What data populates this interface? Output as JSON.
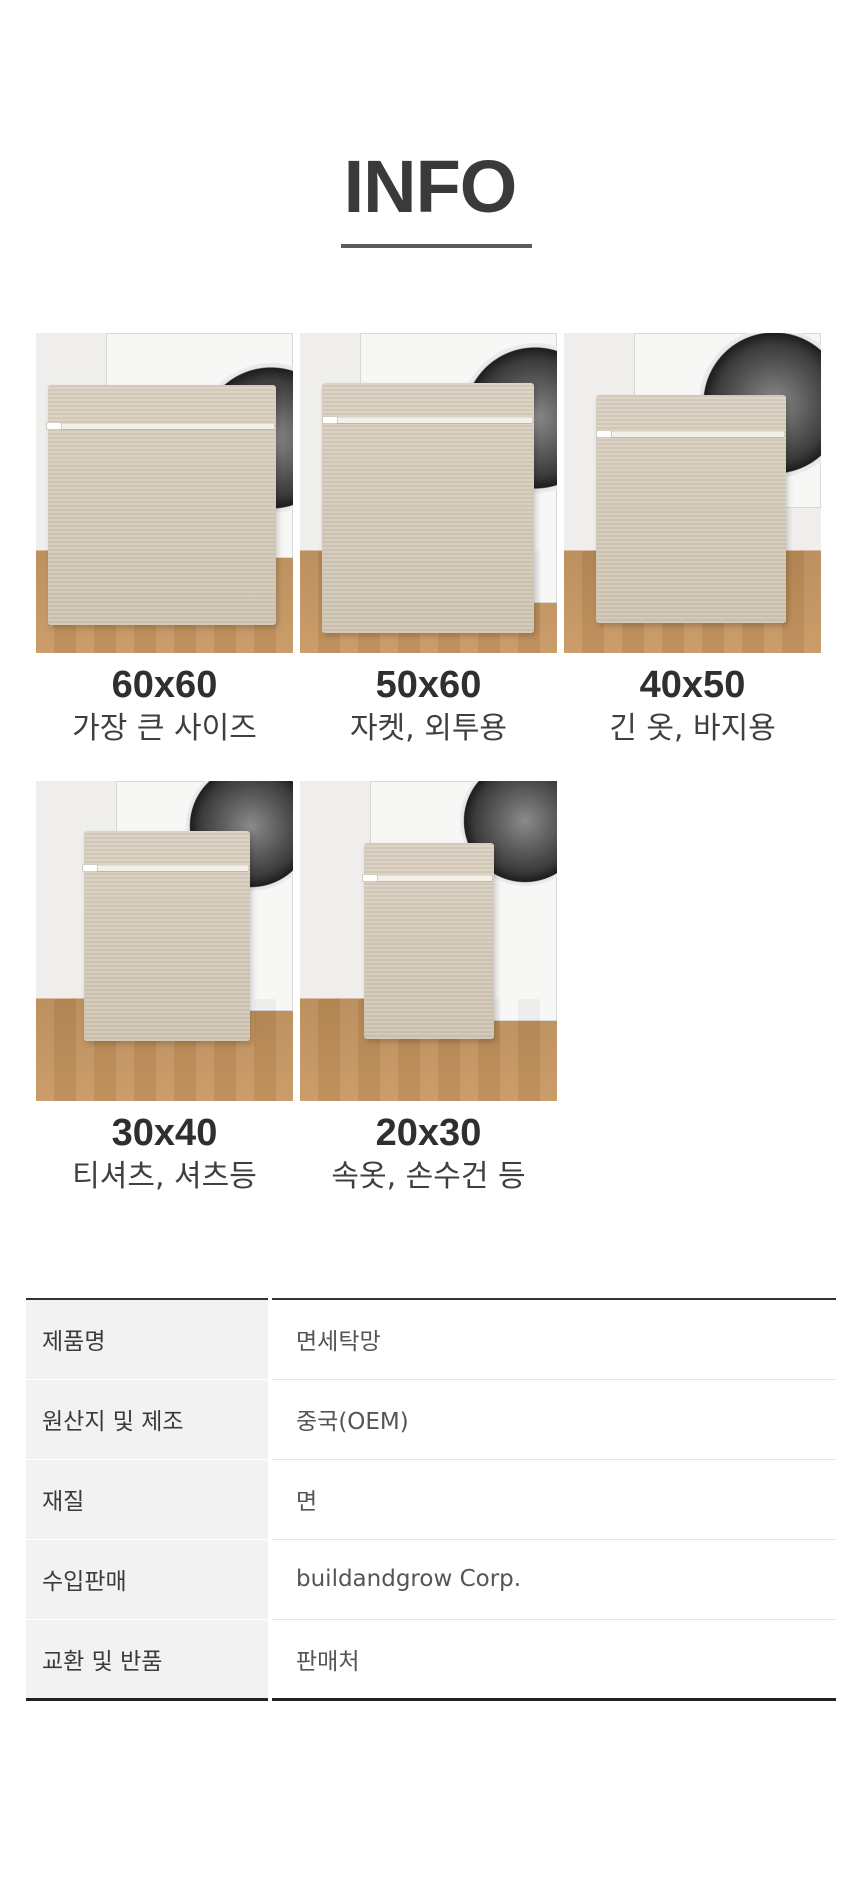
{
  "header": {
    "title": "INFO"
  },
  "products": [
    {
      "size": "60x60",
      "use": "가장 큰 사이즈"
    },
    {
      "size": "50x60",
      "use": "자켓, 외투용"
    },
    {
      "size": "40x50",
      "use": "긴 옷, 바지용"
    },
    {
      "size": "30x40",
      "use": "티셔츠, 셔츠등"
    },
    {
      "size": "20x30",
      "use": "속옷, 손수건 등"
    }
  ],
  "spec_table": [
    {
      "label": "제품명",
      "value": "면세탁망"
    },
    {
      "label": "원산지 및 제조",
      "value": "중국(OEM)"
    },
    {
      "label": "재질",
      "value": "면"
    },
    {
      "label": "수입판매",
      "value": "buildandgrow Corp."
    },
    {
      "label": "교환 및 반품",
      "value": "판매처"
    }
  ]
}
